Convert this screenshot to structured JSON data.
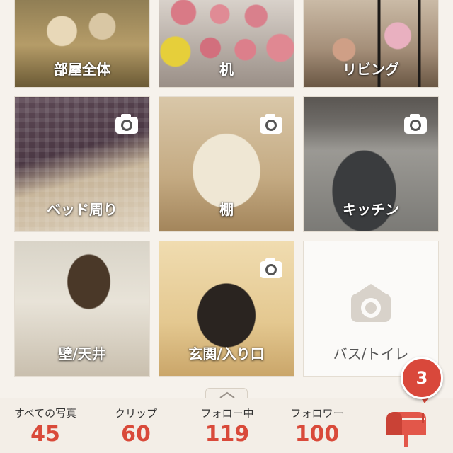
{
  "rooms": [
    {
      "label": "部屋全体",
      "has_camera": false
    },
    {
      "label": "机",
      "has_camera": false
    },
    {
      "label": "リビング",
      "has_camera": false
    },
    {
      "label": "ベッド周り",
      "has_camera": true
    },
    {
      "label": "棚",
      "has_camera": true
    },
    {
      "label": "キッチン",
      "has_camera": true
    },
    {
      "label": "壁/天井",
      "has_camera": false
    },
    {
      "label": "玄関/入り口",
      "has_camera": true
    },
    {
      "label": "バス/トイレ",
      "has_camera": false,
      "empty": true
    }
  ],
  "stats": [
    {
      "label": "すべての写真",
      "value": "45"
    },
    {
      "label": "クリップ",
      "value": "60"
    },
    {
      "label": "フォロー中",
      "value": "119"
    },
    {
      "label": "フォロワー",
      "value": "100"
    }
  ],
  "notifications": {
    "count": "3",
    "icon": "mailbox-icon"
  },
  "colors": {
    "accent": "#d94a3a",
    "background": "#f6f2ec"
  }
}
